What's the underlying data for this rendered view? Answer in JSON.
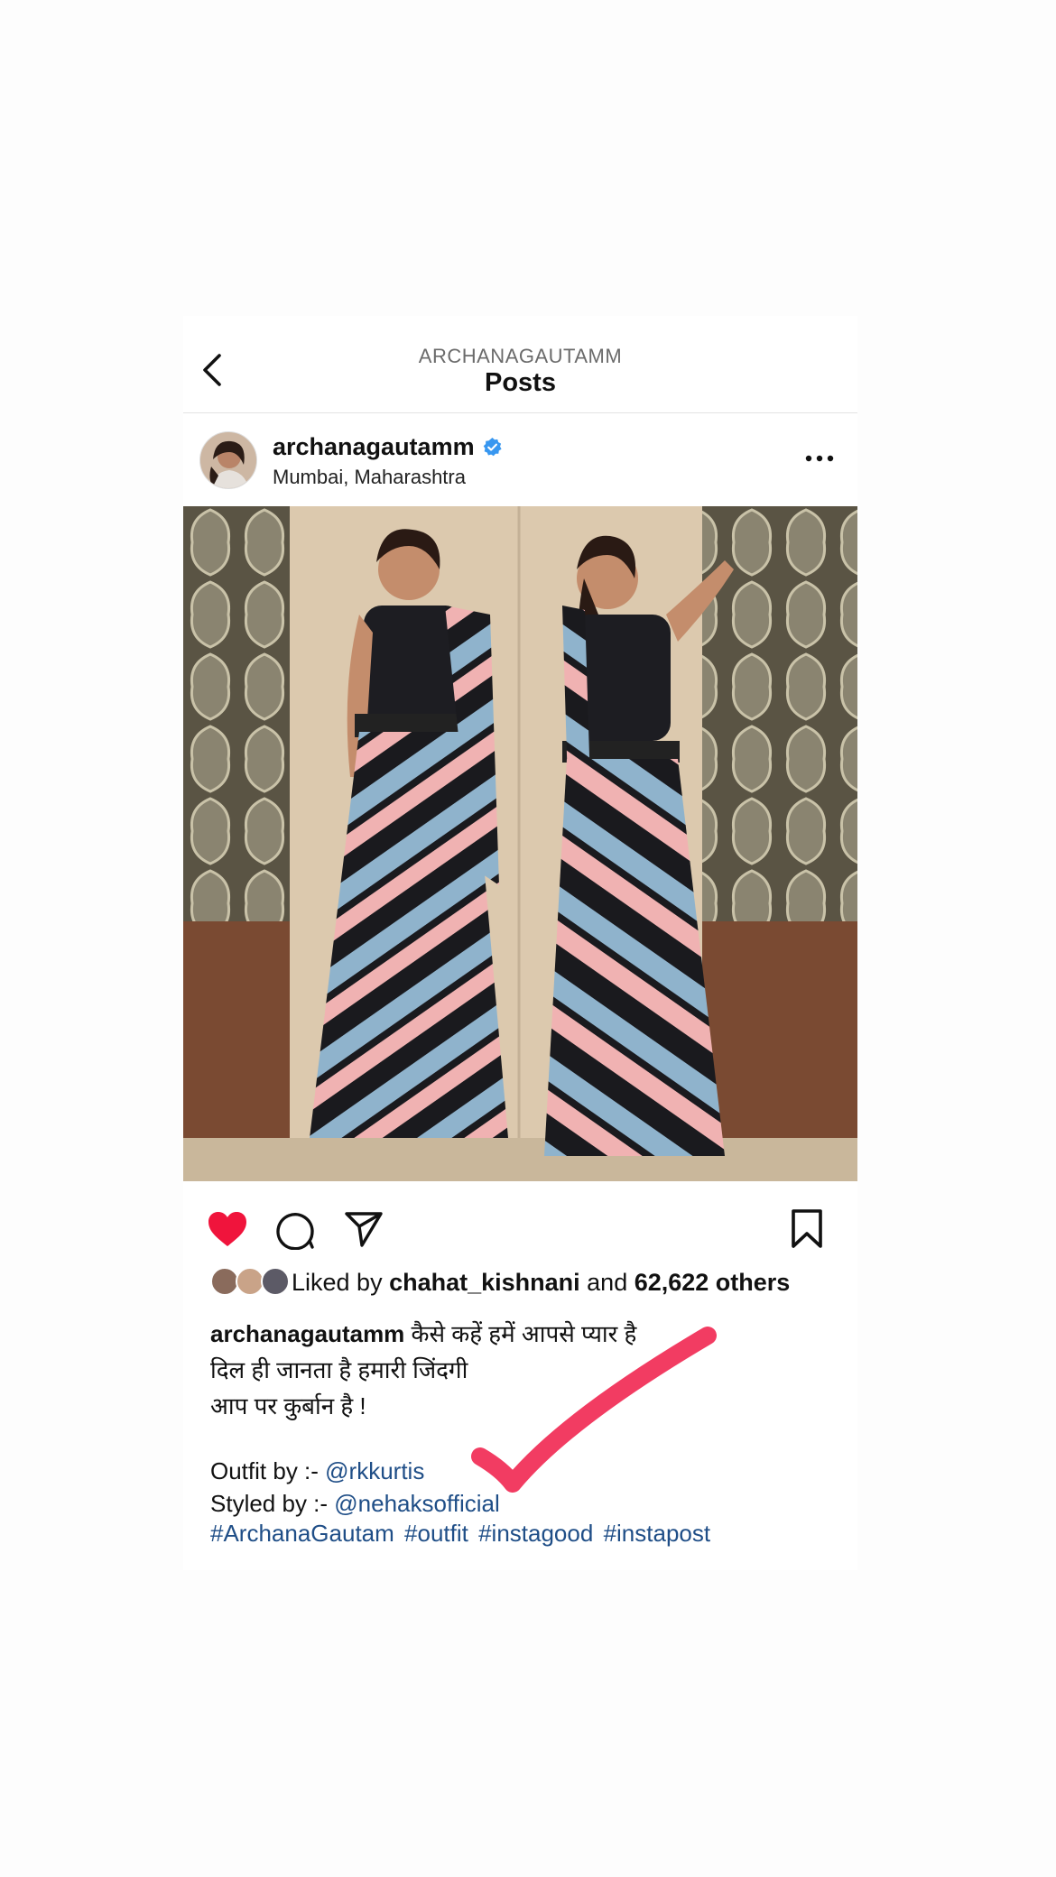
{
  "nav": {
    "subtitle": "ARCHANAGAUTAMM",
    "title": "Posts"
  },
  "post": {
    "username": "archanagautamm",
    "location": "Mumbai, Maharashtra",
    "liked_by_prefix": "Liked by ",
    "liked_by_user": "chahat_kishnani",
    "liked_by_and": " and ",
    "liked_by_count": "62,622 others",
    "caption_user": "archanagautamm",
    "caption_line1": " कैसे कहें हमें आपसे प्यार है",
    "caption_line2": "दिल ही जानता है हमारी जिंदगी",
    "caption_line3": "आप पर कुर्बान है !",
    "outfit_label": "Outfit by :- ",
    "outfit_handle": "@rkkurtis",
    "styled_label": "Styled by :- ",
    "styled_handle": "@nehaksofficial",
    "hashtags": [
      "#ArchanaGautam",
      "#outfit",
      "#instagood",
      "#instapost"
    ]
  },
  "icons": {
    "back": "chevron-left-icon",
    "verified": "verified-badge-icon",
    "more": "more-horizontal-icon",
    "like": "heart-filled-icon",
    "comment": "comment-icon",
    "share": "send-icon",
    "save": "bookmark-icon"
  },
  "colors": {
    "like_red": "#f0143c",
    "verified_blue": "#3897f0",
    "link_blue": "#1f4e87",
    "annotation_pink": "#f23c62"
  }
}
